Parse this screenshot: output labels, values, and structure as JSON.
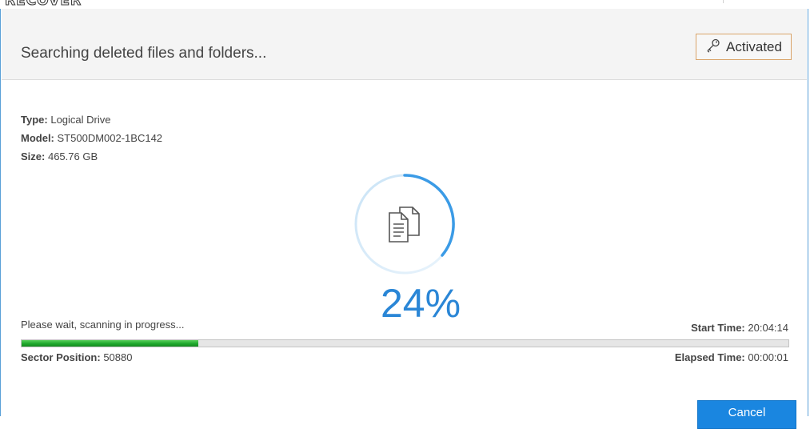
{
  "app": {
    "logo_text": "RECOVER"
  },
  "header": {
    "title": "Searching deleted files and folders...",
    "activated_label": "Activated",
    "activated_icon": "key-icon"
  },
  "drive": {
    "type_label": "Type:",
    "type_value": "Logical Drive",
    "model_label": "Model:",
    "model_value": "ST500DM002-1BC142",
    "size_label": "Size:",
    "size_value": "465.76 GB"
  },
  "scan": {
    "center_icon": "document-icon",
    "percent_text": "24%",
    "status_text": "Please wait, scanning in progress...",
    "start_time_label": "Start Time:",
    "start_time_value": "20:04:14",
    "progress_fraction": 0.23,
    "sector_label": "Sector Position:",
    "sector_value": "50880",
    "elapsed_label": "Elapsed Time:",
    "elapsed_value": "00:00:01"
  },
  "footer": {
    "cancel_label": "Cancel"
  },
  "colors": {
    "accent": "#2a86d6",
    "progress_green": "#1fa82c",
    "activated_border": "#d9a46a",
    "cancel_bg": "#1a86e0"
  }
}
